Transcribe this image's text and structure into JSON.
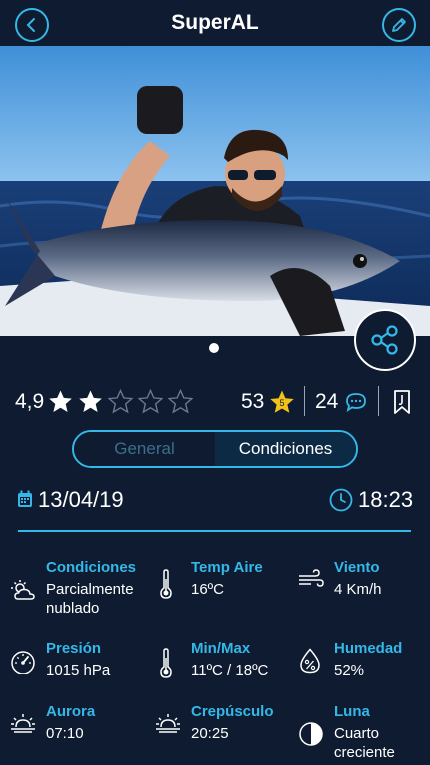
{
  "header": {
    "title": "SuperAL",
    "back_icon": "chevron-left-icon",
    "edit_icon": "pencil-icon"
  },
  "photo": {
    "description_icon": "catch-photo"
  },
  "rating": {
    "value": "4,9",
    "stars_filled": 2,
    "stars_total": 5,
    "likes": "53",
    "badge": "5",
    "comments": "24"
  },
  "tabs": [
    {
      "label": "General",
      "active": false
    },
    {
      "label": "Condiciones",
      "active": true
    }
  ],
  "datetime": {
    "date": "13/04/19",
    "time": "18:23"
  },
  "conditions": [
    {
      "label": "Condiciones",
      "value": "Parcialmente nublado",
      "icon": "cloud-sun-icon"
    },
    {
      "label": "Temp Aire",
      "value": "16ºC",
      "icon": "thermometer-icon"
    },
    {
      "label": "Viento",
      "value": "4 Km/h",
      "icon": "wind-icon"
    },
    {
      "label": "Presión",
      "value": "1015 hPa",
      "icon": "gauge-icon"
    },
    {
      "label": "Min/Max",
      "value": "11ºC / 18ºC",
      "icon": "thermometer-icon"
    },
    {
      "label": "Humedad",
      "value": "52%",
      "icon": "humidity-icon"
    },
    {
      "label": "Aurora",
      "value": "07:10",
      "icon": "sunrise-icon"
    },
    {
      "label": "Crepúsculo",
      "value": "20:25",
      "icon": "sunset-icon"
    },
    {
      "label": "Luna",
      "value": "Cuarto creciente",
      "icon": "moon-half-icon"
    }
  ],
  "colors": {
    "background": "#0f1b31",
    "accent": "#34b8e8",
    "star_gold": "#f2c21b"
  }
}
